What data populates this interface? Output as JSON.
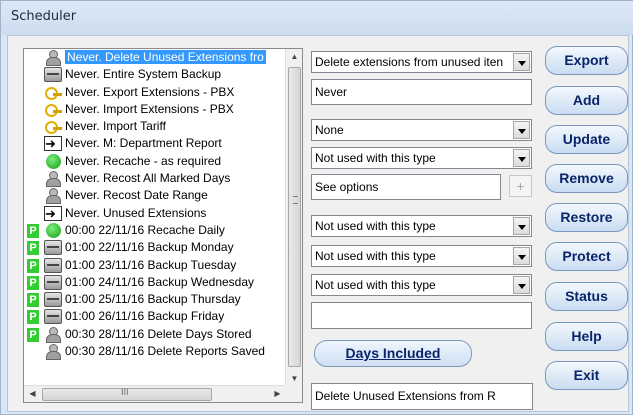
{
  "window": {
    "title": "Scheduler"
  },
  "tasks": [
    {
      "text": "Never.  Delete Unused Extensions fro",
      "icon": "disk-person-icon",
      "p": "",
      "selected": true
    },
    {
      "text": "Never.  Entire System Backup",
      "icon": "disk-icon",
      "p": "",
      "selected": false
    },
    {
      "text": "Never.  Export Extensions - PBX",
      "icon": "key-icon",
      "p": "",
      "selected": false
    },
    {
      "text": "Never.  Import Extensions - PBX",
      "icon": "key-icon",
      "p": "",
      "selected": false
    },
    {
      "text": "Never.  Import Tariff",
      "icon": "key-icon",
      "p": "",
      "selected": false
    },
    {
      "text": "Never.  M: Department Report",
      "icon": "report-icon",
      "p": "",
      "selected": false
    },
    {
      "text": "Never.  Recache - as required",
      "icon": "globe-icon",
      "p": "",
      "selected": false
    },
    {
      "text": "Never.  Recost All Marked Days",
      "icon": "person-icon",
      "p": "",
      "selected": false
    },
    {
      "text": "Never.  Recost Date Range",
      "icon": "person-icon",
      "p": "",
      "selected": false
    },
    {
      "text": "Never.  Unused Extensions",
      "icon": "report-icon",
      "p": "",
      "selected": false
    },
    {
      "text": "00:00 22/11/16 Recache Daily",
      "icon": "globe-icon",
      "p": "P",
      "selected": false
    },
    {
      "text": "01:00 22/11/16 Backup Monday",
      "icon": "disk-icon",
      "p": "P",
      "selected": false
    },
    {
      "text": "01:00 23/11/16 Backup Tuesday",
      "icon": "disk-icon",
      "p": "P",
      "selected": false
    },
    {
      "text": "01:00 24/11/16 Backup Wednesday",
      "icon": "disk-icon",
      "p": "P",
      "selected": false
    },
    {
      "text": "01:00 25/11/16 Backup Thursday",
      "icon": "disk-icon",
      "p": "P",
      "selected": false
    },
    {
      "text": "01:00 26/11/16 Backup Friday",
      "icon": "disk-icon",
      "p": "P",
      "selected": false
    },
    {
      "text": "00:30 28/11/16 Delete Days Stored",
      "icon": "person-icon",
      "p": "P",
      "selected": false
    },
    {
      "text": "00:30 28/11/16 Delete Reports Saved",
      "icon": "person-icon",
      "p": "",
      "selected": false
    }
  ],
  "options": {
    "task_type": "Delete extensions from unused iten",
    "frequency": "Never",
    "option1": "None",
    "option2": "Not used with this type",
    "option3_text": "See options",
    "plus_label": "+",
    "option4": "Not used with this type",
    "option5": "Not used with this type",
    "option6": "Not used with this type",
    "blank_field": "",
    "days_included": "Days Included",
    "task_name": "Delete Unused Extensions from R"
  },
  "buttons": {
    "export": "Export",
    "add": "Add",
    "update": "Update",
    "remove": "Remove",
    "restore": "Restore",
    "protect": "Protect",
    "status": "Status",
    "help": "Help",
    "exit": "Exit"
  },
  "scroll": {
    "up": "▲",
    "down": "▼",
    "left": "◀",
    "right": "▶"
  },
  "colors": {
    "selection": "#3399ff",
    "protect_badge": "#33cc33",
    "button_text": "#0a246a"
  }
}
